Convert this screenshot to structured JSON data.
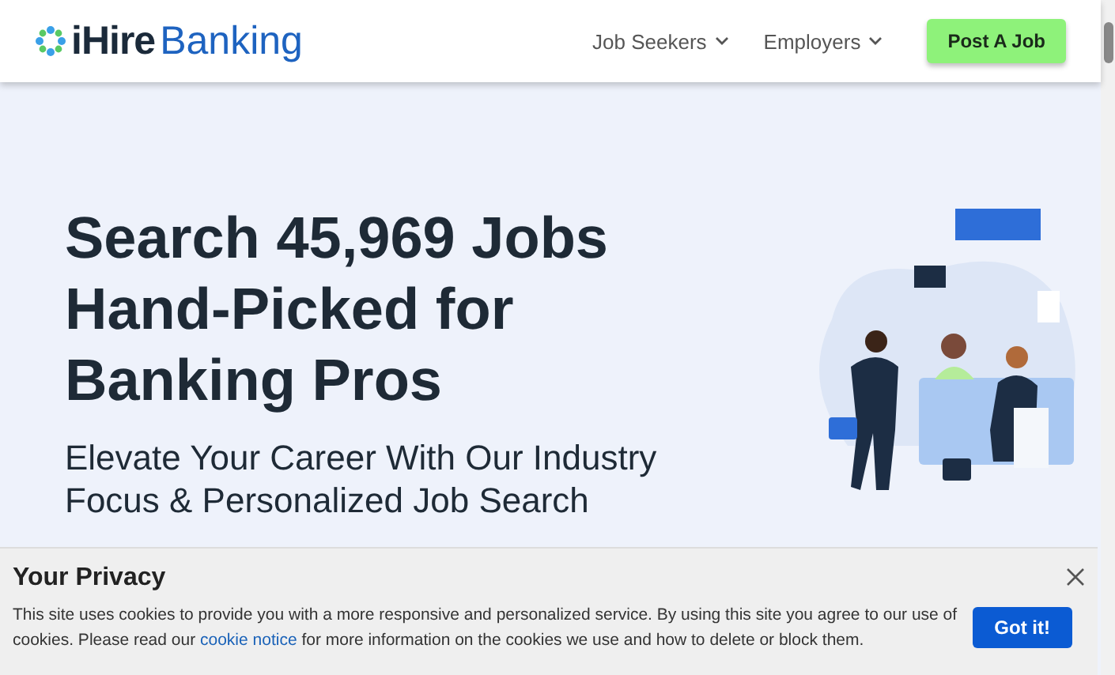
{
  "header": {
    "logo": {
      "brand": "iHire",
      "section": "Banking"
    },
    "nav": [
      {
        "label": "Job Seekers",
        "kind": "dropdown"
      },
      {
        "label": "Employers",
        "kind": "dropdown"
      },
      {
        "label": "Post A Job",
        "kind": "button"
      }
    ]
  },
  "hero": {
    "headline": [
      "Search 45,969 Jobs",
      "Hand-Picked for",
      "Banking Pros"
    ],
    "subtitle": "Elevate Your Career With Our Industry Focus & Personalized Job Search"
  },
  "privacy_banner": {
    "title": "Your Privacy",
    "text_before": "This site uses cookies to provide you with a more responsive and personalized service. By using this site you agree to our use of cookies. Please read our",
    "link": "cookie notice",
    "text_after": "for more information on the cookies we use and how to delete or block them.",
    "button": "Got it!"
  }
}
